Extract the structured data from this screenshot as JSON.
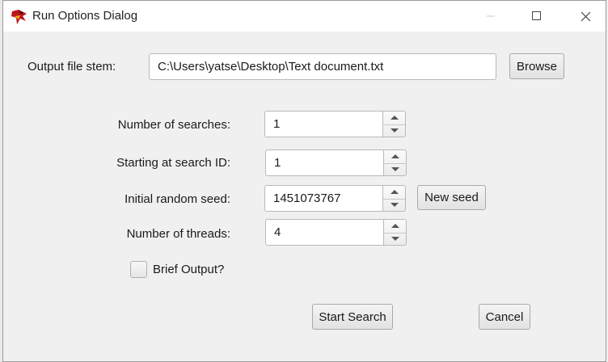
{
  "window": {
    "title": "Run Options Dialog",
    "icon": "red-parrot-app-icon",
    "controls": [
      "minimize-icon",
      "maximize-icon",
      "close-icon"
    ]
  },
  "output_file": {
    "label": "Output file stem:",
    "value": "C:\\Users\\yatse\\Desktop\\Text document.txt",
    "browse_label": "Browse"
  },
  "fields": {
    "num_searches": {
      "label": "Number of searches:",
      "value": "1"
    },
    "start_id": {
      "label": "Starting at search ID:",
      "value": "1"
    },
    "random_seed": {
      "label": "Initial random seed:",
      "value": "1451073767",
      "new_seed_label": "New seed"
    },
    "num_threads": {
      "label": "Number of threads:",
      "value": "4"
    }
  },
  "brief_output": {
    "label": "Brief Output?",
    "checked": false
  },
  "actions": {
    "start_label": "Start Search",
    "cancel_label": "Cancel"
  }
}
